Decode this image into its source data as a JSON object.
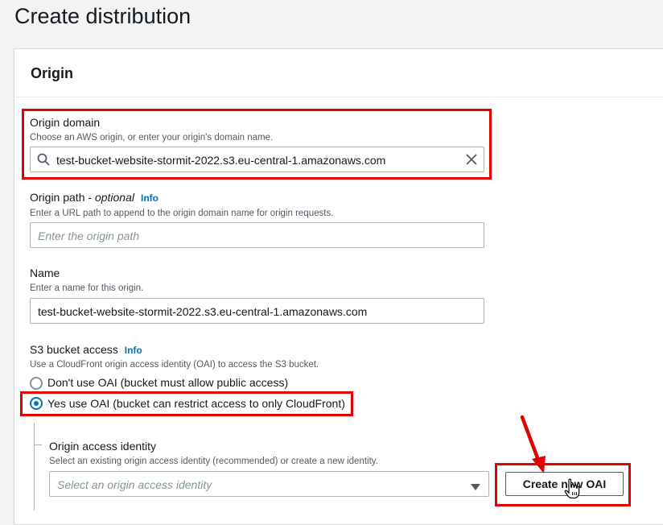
{
  "page": {
    "title": "Create distribution"
  },
  "origin_panel": {
    "title": "Origin",
    "origin_domain": {
      "label": "Origin domain",
      "description": "Choose an AWS origin, or enter your origin's domain name.",
      "value": "test-bucket-website-stormit-2022.s3.eu-central-1.amazonaws.com"
    },
    "origin_path": {
      "label": "Origin path - ",
      "label_optional": "optional",
      "info": "Info",
      "description": "Enter a URL path to append to the origin domain name for origin requests.",
      "placeholder": "Enter the origin path"
    },
    "name": {
      "label": "Name",
      "description": "Enter a name for this origin.",
      "value": "test-bucket-website-stormit-2022.s3.eu-central-1.amazonaws.com"
    },
    "s3_bucket_access": {
      "label": "S3 bucket access",
      "info": "Info",
      "description": "Use a CloudFront origin access identity (OAI) to access the S3 bucket.",
      "options": [
        {
          "label": "Don't use OAI (bucket must allow public access)",
          "selected": false
        },
        {
          "label": "Yes use OAI (bucket can restrict access to only CloudFront)",
          "selected": true
        }
      ]
    },
    "origin_access_identity": {
      "label": "Origin access identity",
      "description": "Select an existing origin access identity (recommended) or create a new identity.",
      "placeholder": "Select an origin access identity",
      "create_button": "Create new OAI"
    }
  },
  "colors": {
    "accent": "#0073bb",
    "annotation_red": "#e30000",
    "background": "#f2f3f3"
  }
}
